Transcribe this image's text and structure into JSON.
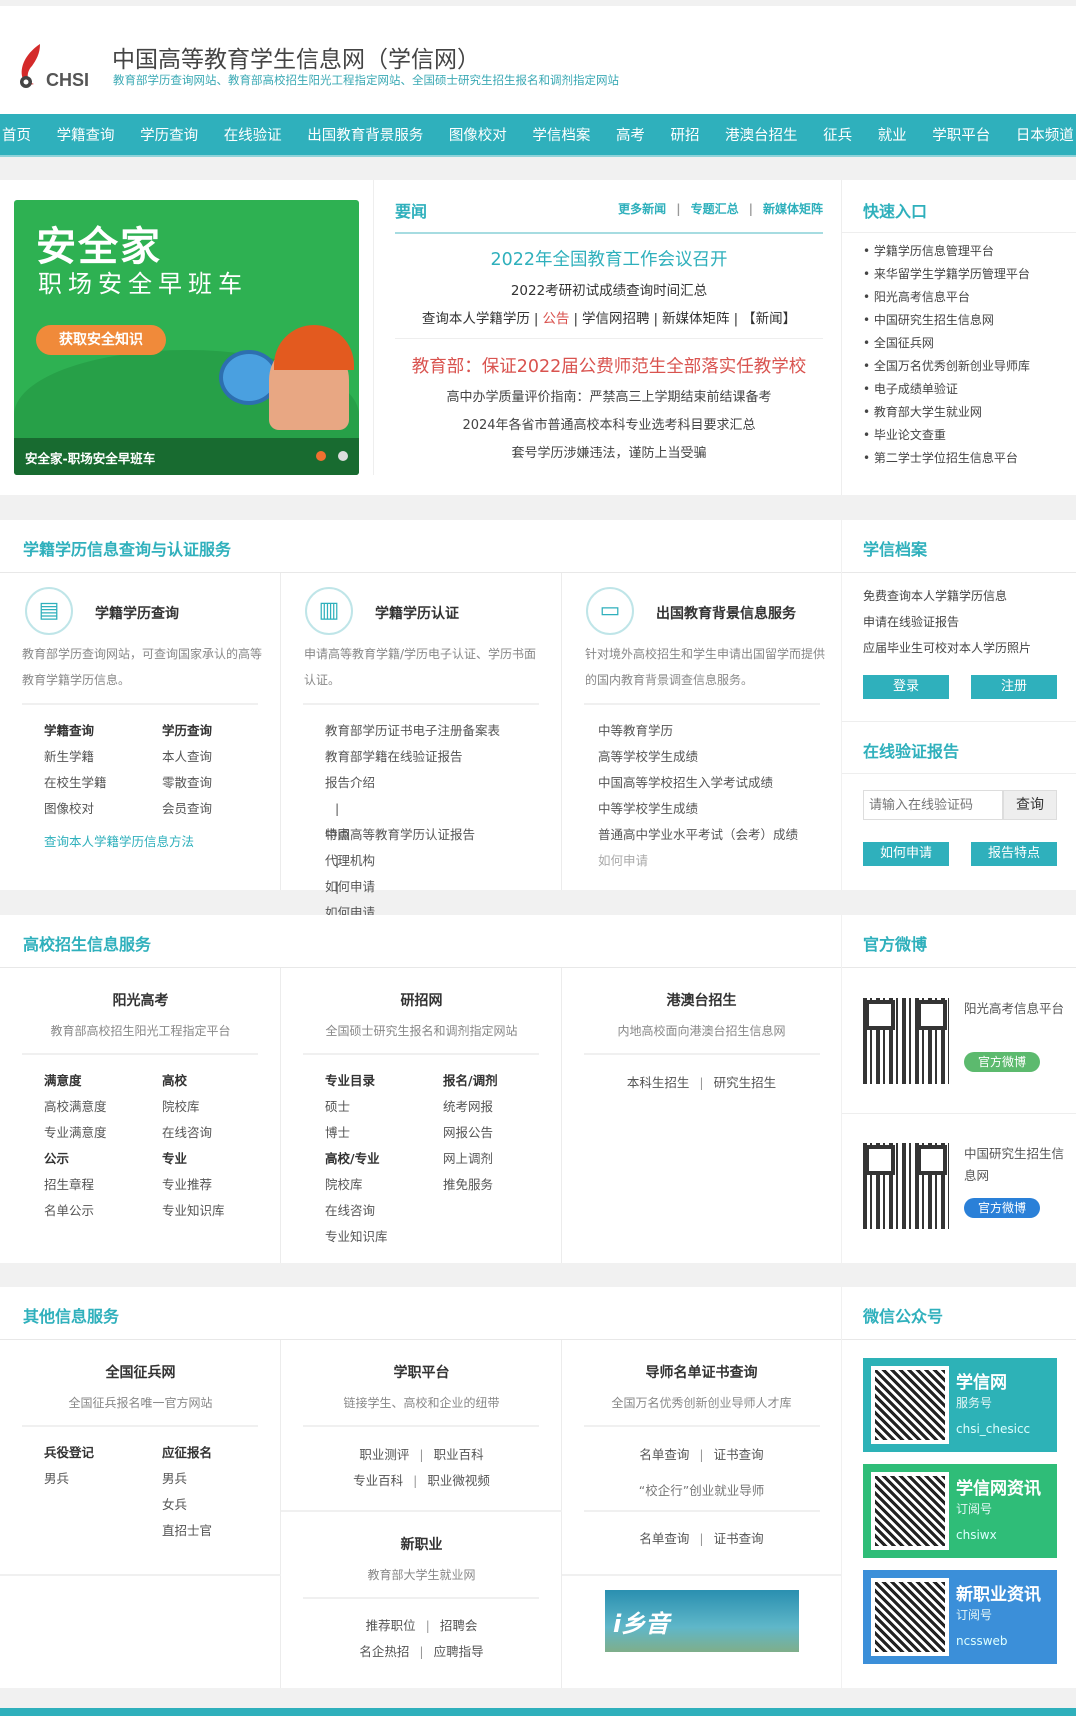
{
  "header": {
    "logo_text": "CHSI",
    "title": "中国高等教育学生信息网（学信网）",
    "subtitle": "教育部学历查询网站、教育部高校招生阳光工程指定网站、全国硕士研究生招生报名和调剂指定网站"
  },
  "nav": [
    "首页",
    "学籍查询",
    "学历查询",
    "在线验证",
    "出国教育背景服务",
    "图像校对",
    "学信档案",
    "高考",
    "研招",
    "港澳台招生",
    "征兵",
    "就业",
    "学职平台",
    "日本频道"
  ],
  "banner": {
    "brand": "安全家",
    "slogan": "职场安全早班车",
    "button": "获取安全知识",
    "caption": "安全家-职场安全早班车",
    "slide_count": 2,
    "active_slide": 1
  },
  "news": {
    "heading": "要闻",
    "top_links": [
      "更多新闻",
      "专题汇总",
      "新媒体矩阵"
    ],
    "headline1": "2022年全国教育工作会议召开",
    "sub1": "2022考研初试成绩查询时间汇总",
    "link_row": [
      {
        "t": "查询本人学籍学历",
        "red": false
      },
      {
        "t": "公告",
        "red": true
      },
      {
        "t": "学信网招聘",
        "red": false
      },
      {
        "t": "新媒体矩阵",
        "red": false
      },
      {
        "t": "【新闻】",
        "red": false
      }
    ],
    "headline2": "教育部：保证2022届公费师范生全部落实任教学校",
    "items": [
      "高中办学质量评价指南：严禁高三上学期结束前结课备考",
      "2024年各省市普通高校本科专业选考科目要求汇总",
      "套号学历涉嫌违法，谨防上当受骗"
    ]
  },
  "quick": {
    "heading": "快速入口",
    "items": [
      "学籍学历信息管理平台",
      "来华留学生学籍学历管理平台",
      "阳光高考信息平台",
      "中国研究生招生信息网",
      "全国征兵网",
      "全国万名优秀创新创业导师库",
      "电子成绩单验证",
      "教育部大学生就业网",
      "毕业论文查重",
      "第二学士学位招生信息平台"
    ]
  },
  "sec2": {
    "heading": "学籍学历信息查询与认证服务",
    "c1": {
      "title": "学籍学历查询",
      "desc": "教育部学历查询网站，可查询国家承认的高等教育学籍学历信息。",
      "grid": [
        {
          "t": "学籍查询",
          "b": true
        },
        {
          "t": "学历查询",
          "b": true
        },
        {
          "t": "新生学籍"
        },
        {
          "t": "本人查询"
        },
        {
          "t": "在校生学籍"
        },
        {
          "t": "零散查询"
        },
        {
          "t": "图像校对"
        },
        {
          "t": "会员查询"
        }
      ],
      "link": "查询本人学籍学历信息方法"
    },
    "c2": {
      "title": "学籍学历认证",
      "desc": "申请高等教育学籍/学历电子认证、学历书面认证。",
      "l1": "教育部学历证书电子注册备案表",
      "l2": "教育部学籍在线验证报告",
      "sub1": [
        "报告介绍",
        "特点",
        "如何申请"
      ],
      "l3": "中国高等教育学历认证报告",
      "sub2": [
        "代理机构",
        "如何申请"
      ]
    },
    "c3": {
      "title": "出国教育背景信息服务",
      "desc": "针对境外高校招生和学生申请出国留学而提供的国内教育背景调查信息服务。",
      "items": [
        "中等教育学历",
        "高等学校学生成绩",
        "中国高等学校招生入学考试成绩",
        "中等学校学生成绩",
        "普通高中学业水平考试（会考）成绩"
      ],
      "apply": "如何申请"
    },
    "archive": {
      "heading": "学信档案",
      "items": [
        "免费查询本人学籍学历信息",
        "申请在线验证报告",
        "应届毕业生可校对本人学历照片"
      ],
      "login": "登录",
      "register": "注册"
    },
    "verify": {
      "heading": "在线验证报告",
      "placeholder": "请输入在线验证码",
      "query": "查询",
      "how": "如何申请",
      "features": "报告特点"
    }
  },
  "sec3": {
    "heading": "高校招生信息服务",
    "c1": {
      "title": "阳光高考",
      "desc": "教育部高校招生阳光工程指定平台",
      "grid": [
        {
          "t": "满意度",
          "b": true
        },
        {
          "t": "高校",
          "b": true
        },
        {
          "t": "高校满意度"
        },
        {
          "t": "院校库"
        },
        {
          "t": "专业满意度"
        },
        {
          "t": "在线咨询"
        },
        {
          "t": "公示",
          "b": true
        },
        {
          "t": "专业",
          "b": true
        },
        {
          "t": "招生章程"
        },
        {
          "t": "专业推荐"
        },
        {
          "t": "名单公示"
        },
        {
          "t": "专业知识库"
        }
      ]
    },
    "c2": {
      "title": "研招网",
      "desc": "全国硕士研究生报名和调剂指定网站",
      "grid": [
        {
          "t": "专业目录",
          "b": true
        },
        {
          "t": "报名/调剂",
          "b": true
        },
        {
          "t": "硕士"
        },
        {
          "t": "统考网报"
        },
        {
          "t": "博士"
        },
        {
          "t": "网报公告"
        },
        {
          "t": "高校/专业",
          "b": true
        },
        {
          "t": "网上调剂"
        },
        {
          "t": "院校库"
        },
        {
          "t": "推免服务"
        },
        {
          "t": "在线咨询"
        },
        {
          "t": ""
        },
        {
          "t": "专业知识库"
        },
        {
          "t": ""
        }
      ]
    },
    "c3": {
      "title": "港澳台招生",
      "desc": "内地高校面向港澳台招生信息网",
      "links": [
        "本科生招生",
        "研究生招生"
      ]
    },
    "weibo": {
      "heading": "官方微博",
      "a": {
        "name": "阳光高考信息平台",
        "btn": "官方微博"
      },
      "b": {
        "name": "中国研究生招生信息网",
        "btn": "官方微博"
      }
    }
  },
  "sec4": {
    "heading": "其他信息服务",
    "c1": {
      "title": "全国征兵网",
      "desc": "全国征兵报名唯一官方网站",
      "grid": [
        {
          "t": "兵役登记",
          "b": true
        },
        {
          "t": "应征报名",
          "b": true
        },
        {
          "t": "男兵"
        },
        {
          "t": "男兵"
        },
        {
          "t": ""
        },
        {
          "t": "女兵"
        },
        {
          "t": ""
        },
        {
          "t": "直招士官"
        }
      ]
    },
    "c2": {
      "title": "学职平台",
      "desc": "链接学生、高校和企业的纽带",
      "r1": [
        "职业测评",
        "职业百科"
      ],
      "r2": [
        "专业百科",
        "职业微视频"
      ]
    },
    "c2b": {
      "title": "新职业",
      "desc": "教育部大学生就业网",
      "r1": [
        "推荐职位",
        "招聘会"
      ],
      "r2": [
        "名企热招",
        "应聘指导"
      ]
    },
    "c3": {
      "title": "导师名单证书查询",
      "desc": "全国万名优秀创新创业导师人才库",
      "r1": [
        "名单查询",
        "证书查询"
      ],
      "mid": "“校企行”创业就业导师",
      "r2": [
        "名单查询",
        "证书查询"
      ],
      "banner": "i乡音"
    },
    "wechat": {
      "heading": "微信公众号",
      "cards": [
        {
          "name": "学信网",
          "type": "服务号",
          "id": "chsi_chesicc"
        },
        {
          "name": "学信网资讯",
          "type": "订阅号",
          "id": "chsiwx"
        },
        {
          "name": "新职业资讯",
          "type": "订阅号",
          "id": "ncssweb"
        }
      ]
    }
  },
  "colors": {
    "accent": "#2fb0bc",
    "red": "#d9534f",
    "green": "#5cba6e",
    "blue": "#2a80d8"
  }
}
